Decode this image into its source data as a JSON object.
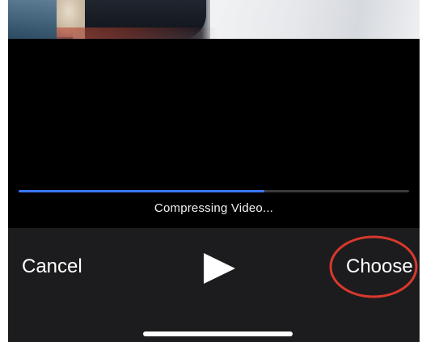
{
  "video": {
    "progress": 0.63,
    "status_text": "Compressing Video..."
  },
  "toolbar": {
    "cancel_label": "Cancel",
    "play_icon": "play-icon",
    "choose_label": "Choose"
  },
  "colors": {
    "background": "#000000",
    "toolbar": "#1c1c1e",
    "progress_fill": "#3a78ff",
    "progress_track": "#3a3a3c",
    "highlight_ring": "#d9382c",
    "text": "#ffffff"
  }
}
